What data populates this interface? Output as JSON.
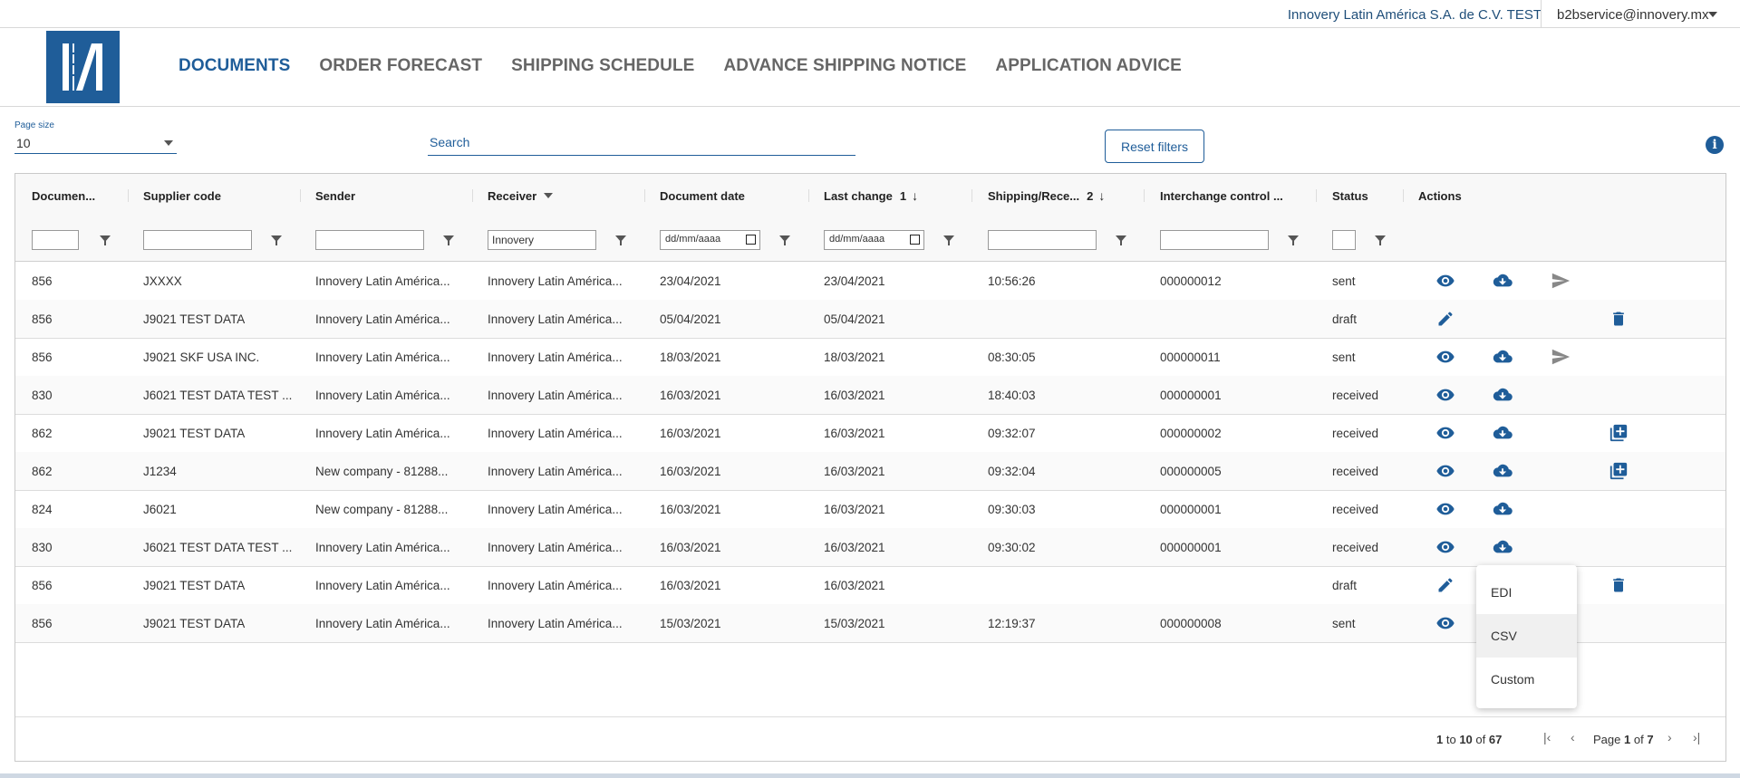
{
  "topbar": {
    "company": "Innovery Latin América S.A. de C.V. TEST",
    "user": "b2bservice@innovery.mx"
  },
  "nav": {
    "items": [
      "DOCUMENTS",
      "ORDER FORECAST",
      "SHIPPING SCHEDULE",
      "ADVANCE SHIPPING NOTICE",
      "APPLICATION ADVICE"
    ],
    "active": "DOCUMENTS"
  },
  "toolbar": {
    "page_size_label": "Page size",
    "page_size_value": "10",
    "search_placeholder": "Search",
    "reset_label": "Reset filters"
  },
  "colors": {
    "brand": "#1f5d99",
    "text": "#333333"
  },
  "table": {
    "columns": [
      {
        "label": "Documen..."
      },
      {
        "label": "Supplier code"
      },
      {
        "label": "Sender"
      },
      {
        "label": "Receiver"
      },
      {
        "label": "Document date"
      },
      {
        "label": "Last change",
        "sort": "1"
      },
      {
        "label": "Shipping/Rece...",
        "sort": "2"
      },
      {
        "label": "Interchange control ..."
      },
      {
        "label": "Status"
      },
      {
        "label": "Actions"
      }
    ],
    "filters": {
      "receiver": "Innovery",
      "date_placeholder": "dd/mm/aaaa"
    },
    "rows": [
      {
        "doc": "856",
        "supplier": "JXXXX",
        "sender": "Innovery Latin América...",
        "receiver": "Innovery Latin América...",
        "date": "23/04/2021",
        "last": "23/04/2021",
        "ship": "10:56:26",
        "icn": "000000012",
        "status": "sent",
        "actions": [
          "view",
          "download",
          "send"
        ]
      },
      {
        "doc": "856",
        "supplier": "J9021 TEST DATA",
        "sender": "Innovery Latin América...",
        "receiver": "Innovery Latin América...",
        "date": "05/04/2021",
        "last": "05/04/2021",
        "ship": "",
        "icn": "",
        "status": "draft",
        "actions": [
          "edit",
          "delete"
        ]
      },
      {
        "doc": "856",
        "supplier": "J9021 SKF USA INC.",
        "sender": "Innovery Latin América...",
        "receiver": "Innovery Latin América...",
        "date": "18/03/2021",
        "last": "18/03/2021",
        "ship": "08:30:05",
        "icn": "000000011",
        "status": "sent",
        "actions": [
          "view",
          "download",
          "send"
        ]
      },
      {
        "doc": "830",
        "supplier": "J6021 TEST DATA TEST ...",
        "sender": "Innovery Latin América...",
        "receiver": "Innovery Latin América...",
        "date": "16/03/2021",
        "last": "16/03/2021",
        "ship": "18:40:03",
        "icn": "000000001",
        "status": "received",
        "actions": [
          "view",
          "download"
        ]
      },
      {
        "doc": "862",
        "supplier": "J9021 TEST DATA",
        "sender": "Innovery Latin América...",
        "receiver": "Innovery Latin América...",
        "date": "16/03/2021",
        "last": "16/03/2021",
        "ship": "09:32:07",
        "icn": "000000002",
        "status": "received",
        "actions": [
          "view",
          "download",
          "add"
        ]
      },
      {
        "doc": "862",
        "supplier": "J1234",
        "sender": "New company - 81288...",
        "receiver": "Innovery Latin América...",
        "date": "16/03/2021",
        "last": "16/03/2021",
        "ship": "09:32:04",
        "icn": "000000005",
        "status": "received",
        "actions": [
          "view",
          "download",
          "add"
        ]
      },
      {
        "doc": "824",
        "supplier": "J6021",
        "sender": "New company - 81288...",
        "receiver": "Innovery Latin América...",
        "date": "16/03/2021",
        "last": "16/03/2021",
        "ship": "09:30:03",
        "icn": "000000001",
        "status": "received",
        "actions": [
          "view",
          "download"
        ]
      },
      {
        "doc": "830",
        "supplier": "J6021 TEST DATA TEST ...",
        "sender": "Innovery Latin América...",
        "receiver": "Innovery Latin América...",
        "date": "16/03/2021",
        "last": "16/03/2021",
        "ship": "09:30:02",
        "icn": "000000001",
        "status": "received",
        "actions": [
          "view",
          "download"
        ]
      },
      {
        "doc": "856",
        "supplier": "J9021 TEST DATA",
        "sender": "Innovery Latin América...",
        "receiver": "Innovery Latin América...",
        "date": "16/03/2021",
        "last": "16/03/2021",
        "ship": "",
        "icn": "",
        "status": "draft",
        "actions": [
          "edit",
          "delete"
        ]
      },
      {
        "doc": "856",
        "supplier": "J9021 TEST DATA",
        "sender": "Innovery Latin América...",
        "receiver": "Innovery Latin América...",
        "date": "15/03/2021",
        "last": "15/03/2021",
        "ship": "12:19:37",
        "icn": "000000008",
        "status": "sent",
        "actions": [
          "view"
        ]
      }
    ]
  },
  "footer": {
    "range_from": "1",
    "range_to_word": "to",
    "range_to": "10",
    "of_word": "of",
    "total": "67",
    "page_word": "Page",
    "page": "1",
    "pages": "7"
  },
  "menu": {
    "items": [
      "EDI",
      "CSV",
      "Custom"
    ],
    "highlighted": "CSV"
  }
}
